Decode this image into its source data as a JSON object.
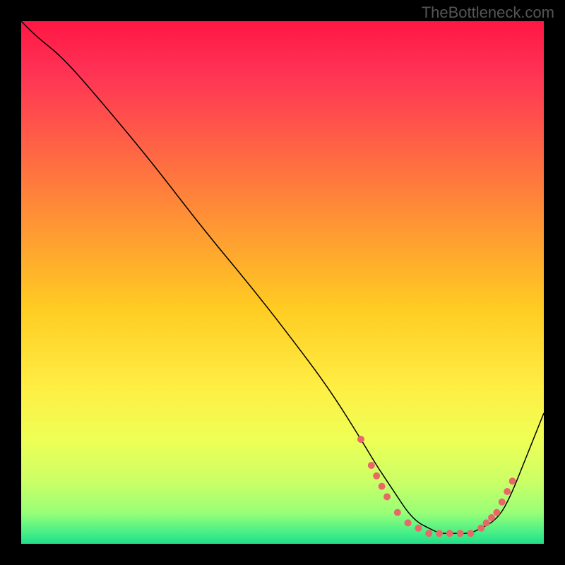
{
  "watermark": "TheBottleneck.com",
  "chart_data": {
    "type": "line",
    "title": "",
    "xlabel": "",
    "ylabel": "",
    "xlim": [
      0,
      100
    ],
    "ylim": [
      0,
      100
    ],
    "series": [
      {
        "name": "curve",
        "x": [
          0,
          3,
          8,
          15,
          25,
          35,
          45,
          55,
          60,
          65,
          68,
          70,
          72,
          74,
          76,
          78,
          80,
          82,
          84,
          86,
          88,
          90,
          92,
          94,
          96,
          98,
          100
        ],
        "y": [
          100,
          97,
          93,
          85,
          73,
          60,
          48,
          35,
          28,
          20,
          15,
          12,
          9,
          6,
          4,
          3,
          2,
          2,
          2,
          2,
          3,
          4,
          6,
          10,
          15,
          20,
          25
        ]
      }
    ],
    "dots": {
      "x": [
        65,
        67,
        68,
        69,
        70,
        72,
        74,
        76,
        78,
        80,
        82,
        84,
        86,
        88,
        89,
        90,
        91,
        92,
        93,
        94
      ],
      "y": [
        20,
        15,
        13,
        11,
        9,
        6,
        4,
        3,
        2,
        2,
        2,
        2,
        2,
        3,
        4,
        5,
        6,
        8,
        10,
        12
      ]
    },
    "gradient_stops": [
      {
        "offset": 0,
        "color": "#ff1744"
      },
      {
        "offset": 10,
        "color": "#ff3355"
      },
      {
        "offset": 25,
        "color": "#ff6644"
      },
      {
        "offset": 40,
        "color": "#ff9933"
      },
      {
        "offset": 55,
        "color": "#ffcc22"
      },
      {
        "offset": 70,
        "color": "#ffee44"
      },
      {
        "offset": 80,
        "color": "#eeff55"
      },
      {
        "offset": 88,
        "color": "#ccff66"
      },
      {
        "offset": 94,
        "color": "#99ff77"
      },
      {
        "offset": 98,
        "color": "#44ee88"
      },
      {
        "offset": 100,
        "color": "#22dd88"
      }
    ]
  }
}
